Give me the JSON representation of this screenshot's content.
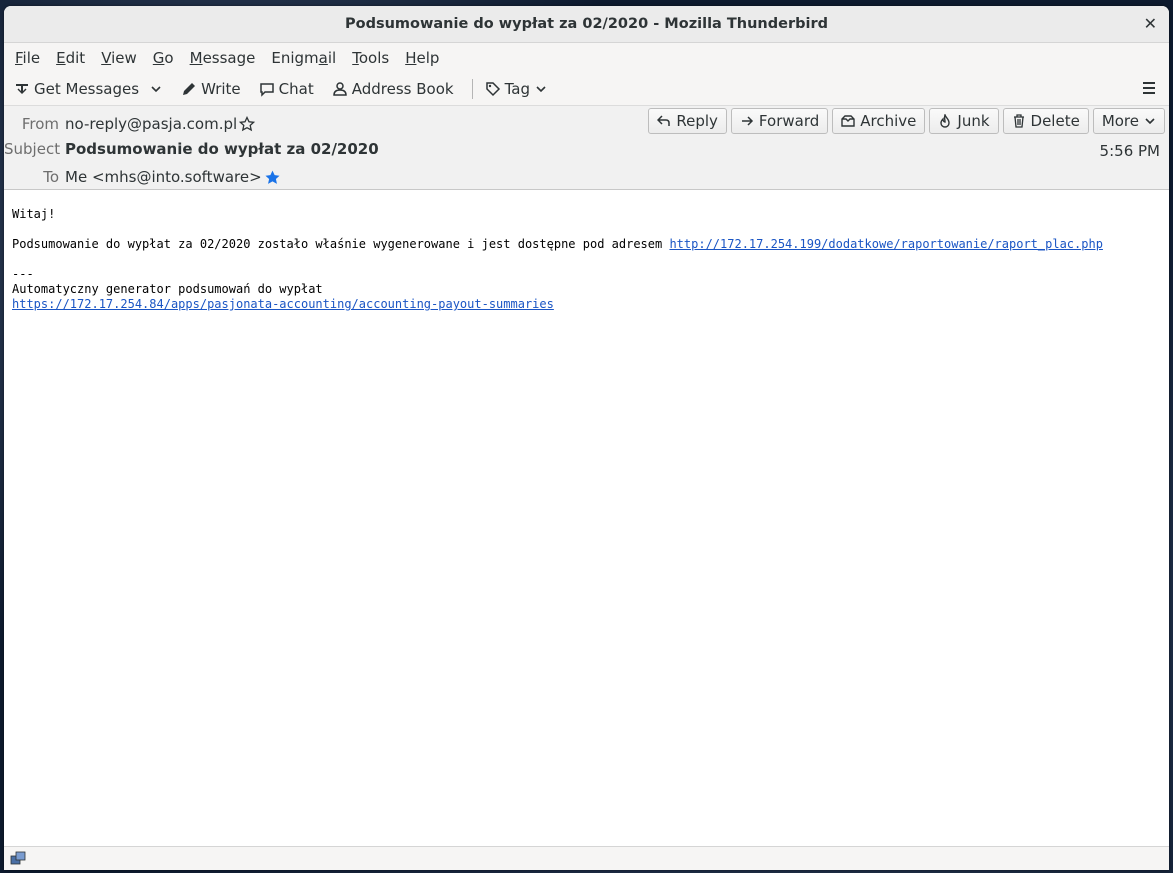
{
  "window": {
    "title": "Podsumowanie do wypłat za 02/2020 - Mozilla Thunderbird",
    "close": "✕"
  },
  "menubar": {
    "file": {
      "pre": "",
      "key": "F",
      "post": "ile"
    },
    "edit": {
      "pre": "",
      "key": "E",
      "post": "dit"
    },
    "view": {
      "pre": "",
      "key": "V",
      "post": "iew"
    },
    "go": {
      "pre": "",
      "key": "G",
      "post": "o"
    },
    "message": {
      "pre": "",
      "key": "M",
      "post": "essage"
    },
    "enigmail": {
      "pre": "Enigm",
      "key": "a",
      "post": "il"
    },
    "tools": {
      "pre": "",
      "key": "T",
      "post": "ools"
    },
    "help": {
      "pre": "",
      "key": "H",
      "post": "elp"
    }
  },
  "toolbar": {
    "get_messages": "Get Messages",
    "write": "Write",
    "chat": "Chat",
    "address_book": "Address Book",
    "tag": "Tag"
  },
  "header": {
    "from_label": "From",
    "from_value": "no-reply@pasja.com.pl",
    "subject_label": "Subject",
    "subject_value": "Podsumowanie do wypłat za 02/2020",
    "to_label": "To",
    "to_value": "Me <mhs@into.software>",
    "time": "5:56 PM",
    "actions": {
      "reply": "Reply",
      "forward": "Forward",
      "archive": "Archive",
      "junk": "Junk",
      "delete": "Delete",
      "more": "More"
    }
  },
  "message": {
    "greeting": "Witaj!",
    "line1_text": "Podsumowanie do wypłat za 02/2020 zostało właśnie wygenerowane i jest dostępne pod adresem ",
    "line1_link": "http://172.17.254.199/dodatkowe/raportowanie/raport_plac.php",
    "sig_sep": "---",
    "sig_name": "Automatyczny generator podsumowań do wypłat",
    "sig_link": "https://172.17.254.84/apps/pasjonata-accounting/accounting-payout-summaries"
  }
}
